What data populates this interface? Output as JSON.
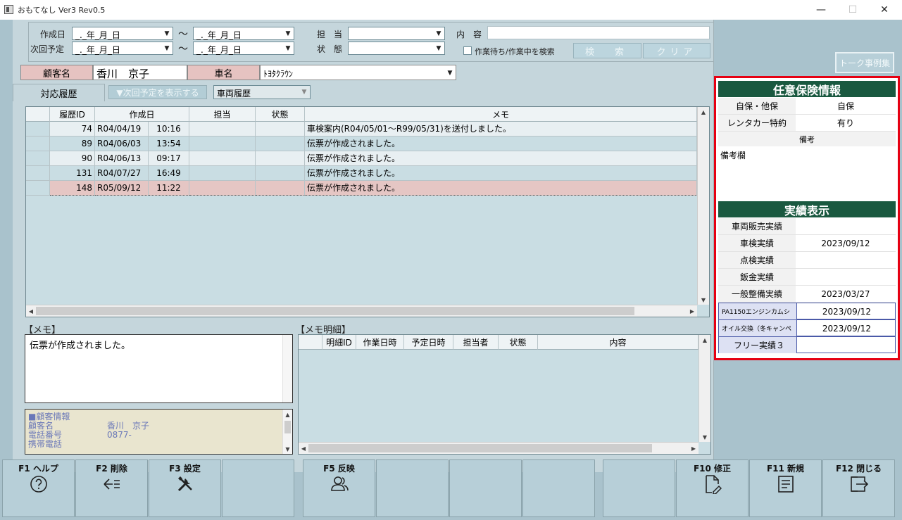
{
  "window": {
    "title": "おもてなし Ver3 Rev0.5",
    "minimize": "—",
    "maximize": "☐",
    "close": "✕"
  },
  "search": {
    "created_label": "作成日",
    "next_label": "次回予定",
    "date_placeholder": "_._年_月_日",
    "tilde": "〜",
    "staff_label": "担　当",
    "status_label": "状　態",
    "content_label": "内　容",
    "checkbox_label": "作業待ち/作業中を検索",
    "search_btn": "検　索",
    "clear_btn": "クリア"
  },
  "talk_example_btn": "トーク事例集",
  "customer": {
    "label": "顧客名",
    "value": "香川　京子",
    "car_label": "車名",
    "car_value": "ﾄﾖﾀｸﾗｳﾝ"
  },
  "tabs": {
    "history": "対応履歴",
    "show_next": "▼次回予定を表示する",
    "vehicle_history": "車両履歴"
  },
  "history_grid": {
    "headers": [
      "履歴ID",
      "作成日",
      "担当",
      "状態",
      "メモ"
    ],
    "rows": [
      {
        "id": "74",
        "date": "R04/04/19",
        "time": "10:16",
        "staff": "",
        "status": "",
        "memo": "車検案内(R04/05/01〜R99/05/31)を送付しました。"
      },
      {
        "id": "89",
        "date": "R04/06/03",
        "time": "13:54",
        "staff": "",
        "status": "",
        "memo": "伝票が作成されました。"
      },
      {
        "id": "90",
        "date": "R04/06/13",
        "time": "09:17",
        "staff": "",
        "status": "",
        "memo": "伝票が作成されました。"
      },
      {
        "id": "131",
        "date": "R04/07/27",
        "time": "16:49",
        "staff": "",
        "status": "",
        "memo": "伝票が作成されました。"
      },
      {
        "id": "148",
        "date": "R05/09/12",
        "time": "11:22",
        "staff": "",
        "status": "",
        "memo": "伝票が作成されました。"
      }
    ]
  },
  "memo": {
    "label": "【メモ】",
    "text": "伝票が作成されました。"
  },
  "customer_info": {
    "header": "■顧客情報",
    "name_label": "顧客名",
    "name_value": "香川　京子",
    "phone_label": "電話番号",
    "phone_value": "0877-",
    "mobile_label": "携帯電話"
  },
  "memo_detail": {
    "label": "【メモ明細】",
    "headers": [
      "明細ID",
      "作業日時",
      "予定日時",
      "担当者",
      "状態",
      "内容"
    ]
  },
  "insurance": {
    "title": "任意保険情報",
    "rows": [
      {
        "label": "自保・他保",
        "value": "自保"
      },
      {
        "label": "レンタカー特約",
        "value": "有り"
      }
    ],
    "remarks_label": "備考",
    "remarks_text": "備考欄"
  },
  "results": {
    "title": "実績表示",
    "rows": [
      {
        "label": "車両販売実績",
        "value": ""
      },
      {
        "label": "車検実績",
        "value": "2023/09/12"
      },
      {
        "label": "点検実績",
        "value": ""
      },
      {
        "label": "鈑金実績",
        "value": ""
      },
      {
        "label": "一般整備実績",
        "value": "2023/03/27"
      }
    ],
    "free_rows": [
      {
        "label": "PA1150エンジンカムシ",
        "value": "2023/09/12"
      },
      {
        "label": "オイル交換（冬キャンペ",
        "value": "2023/09/12"
      },
      {
        "label": "フリー実績３",
        "value": ""
      }
    ]
  },
  "fkeys": [
    {
      "label": "F1 ヘルプ",
      "icon": "help-icon"
    },
    {
      "label": "F2 削除",
      "icon": "delete-arrow-icon"
    },
    {
      "label": "F3 設定",
      "icon": "tools-icon"
    },
    {
      "label": "",
      "icon": ""
    },
    {
      "label": "F5 反映",
      "icon": "users-icon"
    },
    {
      "label": "",
      "icon": ""
    },
    {
      "label": "",
      "icon": ""
    },
    {
      "label": "",
      "icon": ""
    },
    {
      "label": "",
      "icon": ""
    },
    {
      "label": "F10 修正",
      "icon": "edit-document-icon"
    },
    {
      "label": "F11 新規",
      "icon": "new-document-icon"
    },
    {
      "label": "F12 閉じる",
      "icon": "exit-icon"
    }
  ]
}
